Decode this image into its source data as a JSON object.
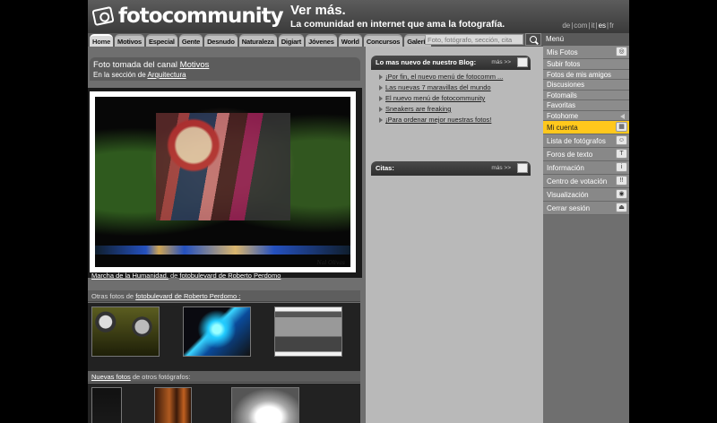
{
  "header": {
    "logo": "fotocommunity",
    "slogan_big": "Ver más.",
    "slogan_small": "La comunidad en internet que ama la fotografía.",
    "languages": [
      "de",
      "com",
      "it",
      "es",
      "fr"
    ],
    "current_language": "es"
  },
  "nav": {
    "tabs": [
      "Home",
      "Motivos",
      "Especial",
      "Gente",
      "Desnudo",
      "Naturaleza",
      "Digiart",
      "Jóvenes",
      "World",
      "Concursos",
      "Galería"
    ],
    "active_tab": "Home",
    "search_placeholder": "Foto, fotógrafo, sección, cita"
  },
  "photo_box": {
    "line1_prefix": "Foto tomada del canal ",
    "channel": "Motivos",
    "line2_prefix": "En la sección de ",
    "section": "Arquitectura",
    "signature": "Nal Olivas",
    "caption_title": "Marcha de la Humanidad.",
    "caption_mid": " de ",
    "caption_author": "fotobulevard de Roberto Perdomo"
  },
  "other_photos": {
    "prefix": "Otras fotos de ",
    "author": "fotobulevard de Roberto Perdomo :"
  },
  "new_photos": {
    "link": "Nuevas fotos",
    "suffix": " de otros fotógrafos:"
  },
  "blog": {
    "title": "Lo mas nuevo de nuestro Blog:",
    "more": "más >>",
    "items": [
      "¡Por fin, el nuevo menú de fotocomm ...",
      "Las nuevas 7 maravillas del mundo",
      "El nuevo menú de fotocommunity",
      "Sneakers are freaking",
      "¡Para ordenar mejor nuestras fotos!"
    ]
  },
  "citas": {
    "title": "Citas:",
    "more": "más >>"
  },
  "menu": {
    "title": "Menú",
    "mis_fotos": "Mis Fotos",
    "sub_items": [
      "Subir fotos",
      "Fotos de mis amigos",
      "Discusiones",
      "Fotomails",
      "Favoritas",
      "Fotohome"
    ],
    "mi_cuenta": "Mi cuenta",
    "lista": "Lista de fotógrafos",
    "foros": "Foros de texto",
    "informacion": "Información",
    "votacion": "Centro de votación",
    "visualizacion": "Visualización",
    "cerrar": "Cerrar sesión",
    "highlight_color": "#ffc81c"
  }
}
